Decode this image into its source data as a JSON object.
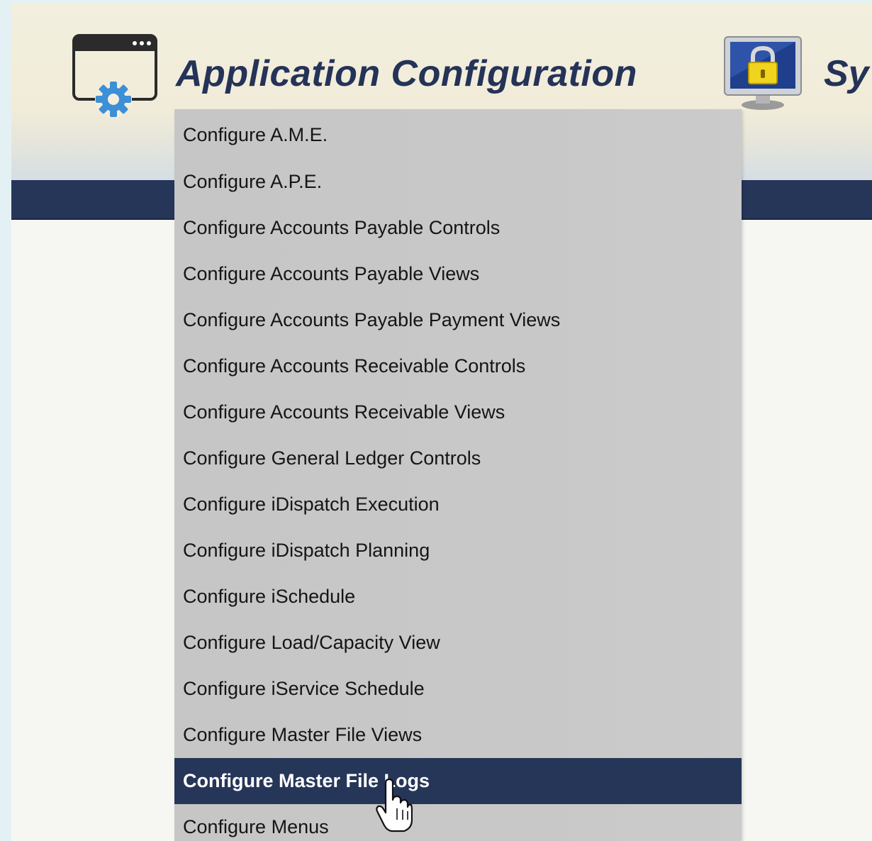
{
  "header": {
    "app_config_title": "Application Configuration",
    "system_title_partial": "Sy",
    "app_icon": "browser-window-gear-icon",
    "system_icon": "monitor-lock-icon"
  },
  "colors": {
    "navbar": "#263659",
    "title_text": "#243357",
    "menu_background": "#c8c8c8",
    "active_item": "#263659",
    "active_item_text": "#ffffff"
  },
  "menu": {
    "items": [
      {
        "label": "Configure A.M.E."
      },
      {
        "label": "Configure A.P.E."
      },
      {
        "label": "Configure Accounts Payable Controls"
      },
      {
        "label": "Configure Accounts Payable Views"
      },
      {
        "label": "Configure Accounts Payable Payment Views"
      },
      {
        "label": "Configure Accounts Receivable Controls"
      },
      {
        "label": "Configure Accounts Receivable Views"
      },
      {
        "label": "Configure General Ledger Controls"
      },
      {
        "label": "Configure iDispatch Execution"
      },
      {
        "label": "Configure iDispatch Planning"
      },
      {
        "label": "Configure iSchedule"
      },
      {
        "label": "Configure Load/Capacity View"
      },
      {
        "label": "Configure iService Schedule"
      },
      {
        "label": "Configure Master File Views"
      },
      {
        "label": "Configure Master File Logs"
      },
      {
        "label": "Configure Menus"
      }
    ],
    "highlighted_label": "Configure Master File Logs"
  },
  "cursor": "hand-pointer-icon"
}
